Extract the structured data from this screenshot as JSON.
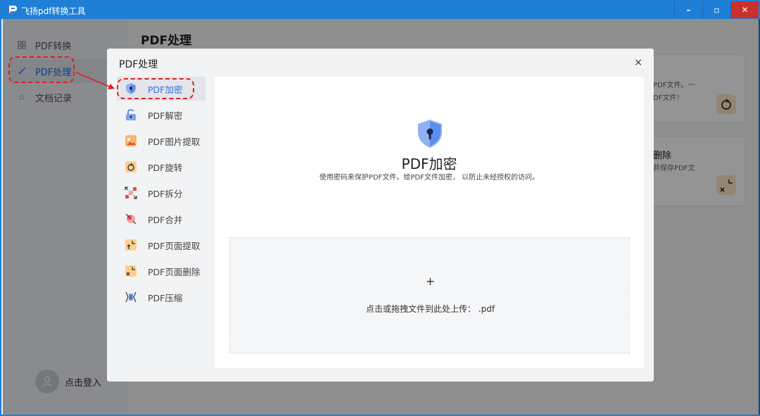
{
  "window": {
    "title": "飞扬pdf转换工具",
    "controls": {
      "minimize": "–",
      "maximize": "▫",
      "close": "✕"
    }
  },
  "sidebar": {
    "items": [
      {
        "label": "PDF转换",
        "icon": "grid-icon"
      },
      {
        "label": "PDF处理",
        "icon": "magic-wand-icon"
      },
      {
        "label": "文档记录",
        "icon": "star-icon"
      }
    ],
    "login_label": "点击登入"
  },
  "main": {
    "page_title": "PDF处理",
    "cards": [
      {
        "line1": "PDF文件。一",
        "line2": "DF文件！"
      },
      {
        "line1": "删除",
        "line2": "并保存PDF文"
      }
    ]
  },
  "dialog": {
    "title": "PDF处理",
    "close": "×",
    "menu": [
      {
        "label": "PDF加密",
        "icon": "shield-lock-icon",
        "active": true
      },
      {
        "label": "PDF解密",
        "icon": "unlock-icon"
      },
      {
        "label": "PDF图片提取",
        "icon": "image-extract-icon"
      },
      {
        "label": "PDF旋转",
        "icon": "rotate-icon"
      },
      {
        "label": "PDF拆分",
        "icon": "split-icon"
      },
      {
        "label": "PDF合并",
        "icon": "merge-icon"
      },
      {
        "label": "PDF页面提取",
        "icon": "page-extract-icon"
      },
      {
        "label": "PDF页面删除",
        "icon": "page-delete-icon"
      },
      {
        "label": "PDF压缩",
        "icon": "compress-icon"
      }
    ],
    "panel": {
      "title": "PDF加密",
      "description": "使用密码来保护PDF文件。给PDF文件加密， 以防止未经授权的访问。",
      "dropzone_plus": "+",
      "dropzone_text": "点击或拖拽文件到此处上传：  .pdf"
    }
  },
  "colors": {
    "titlebar": "#1f7fd6",
    "accent": "#2f6fde",
    "annotation": "#e02020"
  }
}
